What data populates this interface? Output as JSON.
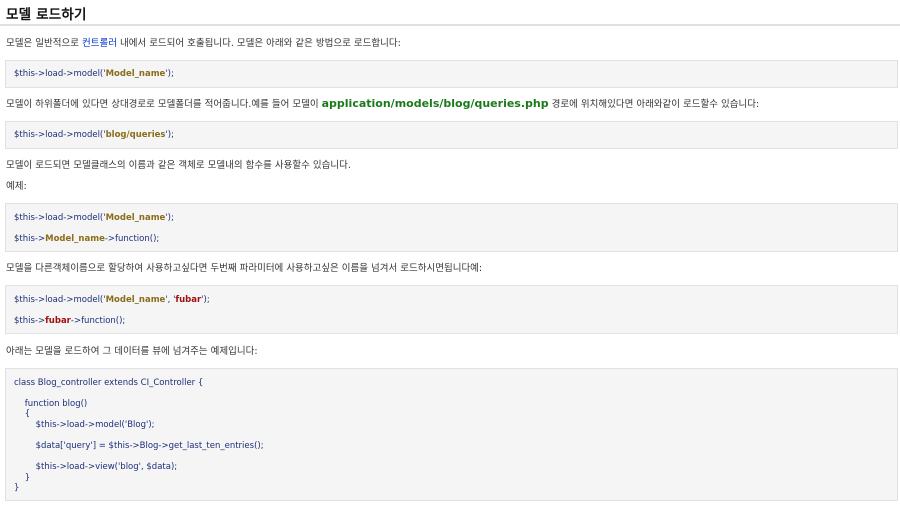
{
  "title": "모델 로드하기",
  "p1": {
    "before": "모델은 일반적으로 ",
    "link": "컨트롤러",
    "after": " 내에서 로드되어 호출됩니다. 모델은 아래와 같은 방법으로 로드합니다:"
  },
  "code1": {
    "prefix": "$this->load->model('",
    "str": "Model_name",
    "suffix": "');"
  },
  "p2": {
    "before": "모델이 하위폴더에 있다면 상대경로로 모델폴더를 적어줍니다.예를 들어 모델이 ",
    "path": "application/models/blog/queries.php",
    "after": " 경로에 위치해있다면 아래와같이 로드할수 있습니다:"
  },
  "code2": {
    "prefix": "$this->load->model('",
    "str": "blog/queries",
    "suffix": "');"
  },
  "p3": "모델이 로드되면 모델클래스의 이름과 같은 객체로 모델내의 함수를 사용할수 있습니다.",
  "p4": "예제:",
  "code3": {
    "l1_prefix": "$this->load->model('",
    "l1_str": "Model_name",
    "l1_suffix": "');",
    "l2_prefix": "$this->",
    "l2_str": "Model_name",
    "l2_suffix": "->function();"
  },
  "p5": "모델을 다른객체이름으로 할당하여 사용하고싶다면 두번째 파라미터에 사용하고싶은 이름을 넘겨서 로드하시면됩니다예:",
  "code4": {
    "l1_prefix": "$this->load->model('",
    "l1_str": "Model_name",
    "l1_mid": "', '",
    "l1_str2": "fubar",
    "l1_suffix": "');",
    "l2_prefix": "$this->",
    "l2_str": "fubar",
    "l2_suffix": "->function();"
  },
  "p6": "아래는 모델을 로드하여 그 데이터를 뷰에 넘겨주는 예제입니다:",
  "code5": [
    "class Blog_controller extends CI_Controller {",
    "    function blog()",
    "    {",
    "        $this->load->model('Blog');",
    "        $data['query'] = $this->Blog->get_last_ten_entries();",
    "        $this->load->view('blog', $data);",
    "    }",
    "}"
  ]
}
